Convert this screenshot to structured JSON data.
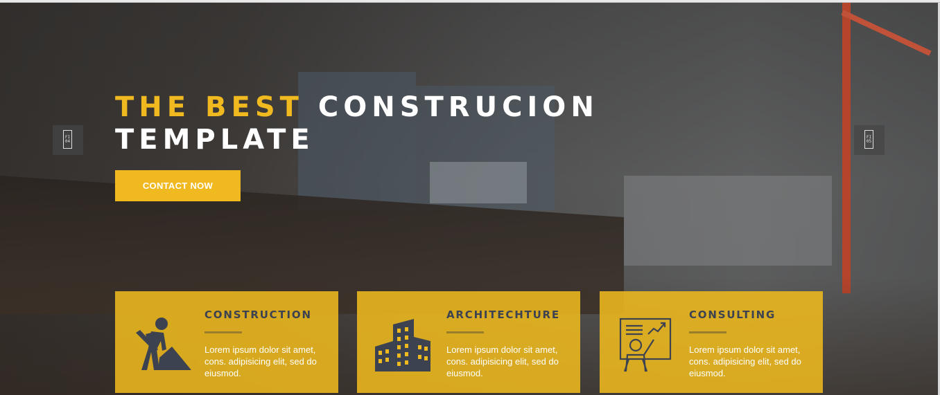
{
  "hero": {
    "title_accent": "THE BEST",
    "title_rest": "CONSTRUCION",
    "title_line2": "TEMPLATE",
    "cta_label": "CONTACT NOW",
    "prev_icon": "previous-slide-icon",
    "next_icon": "next-slide-icon",
    "prev_glyph": "FI 04",
    "next_glyph": "FI 05"
  },
  "services": [
    {
      "title": "CONSTRUCTION",
      "text": "Lorem ipsum dolor sit amet, cons. adipisicing elit, sed do eiusmod.",
      "icon": "worker-digging-icon"
    },
    {
      "title": "ARCHITECHTURE",
      "text": "Lorem ipsum dolor sit amet, cons. adipisicing elit, sed do eiusmod.",
      "icon": "buildings-icon"
    },
    {
      "title": "CONSULTING",
      "text": "Lorem ipsum dolor sit amet, cons. adipisicing elit, sed do eiusmod.",
      "icon": "presentation-board-icon"
    }
  ],
  "colors": {
    "accent": "#f0b91f",
    "card_bg": "#eeba1e",
    "card_title": "#3c4250",
    "icon": "#3c4250"
  }
}
